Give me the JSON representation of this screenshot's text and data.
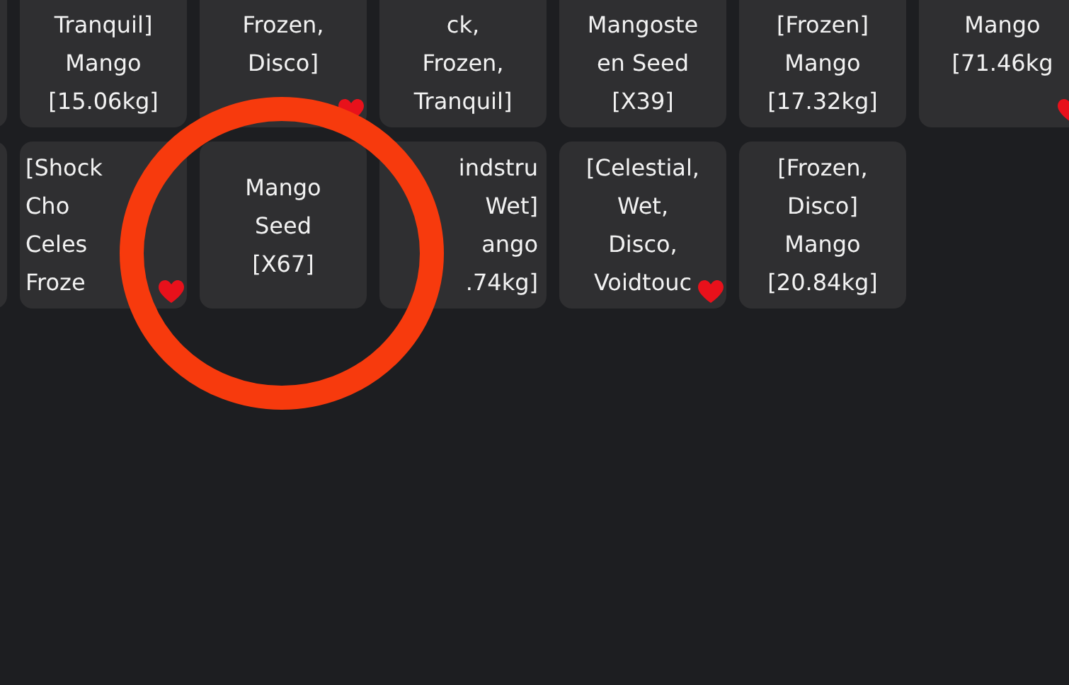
{
  "rows": [
    {
      "items": [
        {
          "lines": [
            "Tranquil]",
            "Mango",
            "[15.06kg]"
          ],
          "favorited": false
        },
        {
          "lines": [
            "Frozen,",
            "Disco]"
          ],
          "favorited": true
        },
        {
          "lines": [
            "ck,",
            "Frozen,",
            "Tranquil]"
          ],
          "favorited": false
        },
        {
          "lines": [
            "Mangoste",
            "en Seed",
            "[X39]"
          ],
          "favorited": false
        },
        {
          "lines": [
            "[Frozen]",
            "Mango",
            "[17.32kg]"
          ],
          "favorited": false
        },
        {
          "lines": [
            "Mango",
            "[71.46kg"
          ],
          "favorited": true
        }
      ]
    },
    {
      "items": [
        {
          "lines": [
            "[Shock",
            "Cho",
            "Celes",
            "Froze"
          ],
          "favorited": true
        },
        {
          "lines": [
            "Mango",
            "Seed",
            "[X67]"
          ],
          "favorited": false
        },
        {
          "lines": [
            "indstru",
            "Wet]",
            "ango",
            ".74kg]"
          ],
          "favorited": false
        },
        {
          "lines": [
            "[Celestial,",
            "Wet,",
            "Disco,",
            "Voidtouc"
          ],
          "favorited": true
        },
        {
          "lines": [
            "[Frozen,",
            "Disco]",
            "Mango",
            "[20.84kg]"
          ],
          "favorited": false
        }
      ]
    }
  ]
}
